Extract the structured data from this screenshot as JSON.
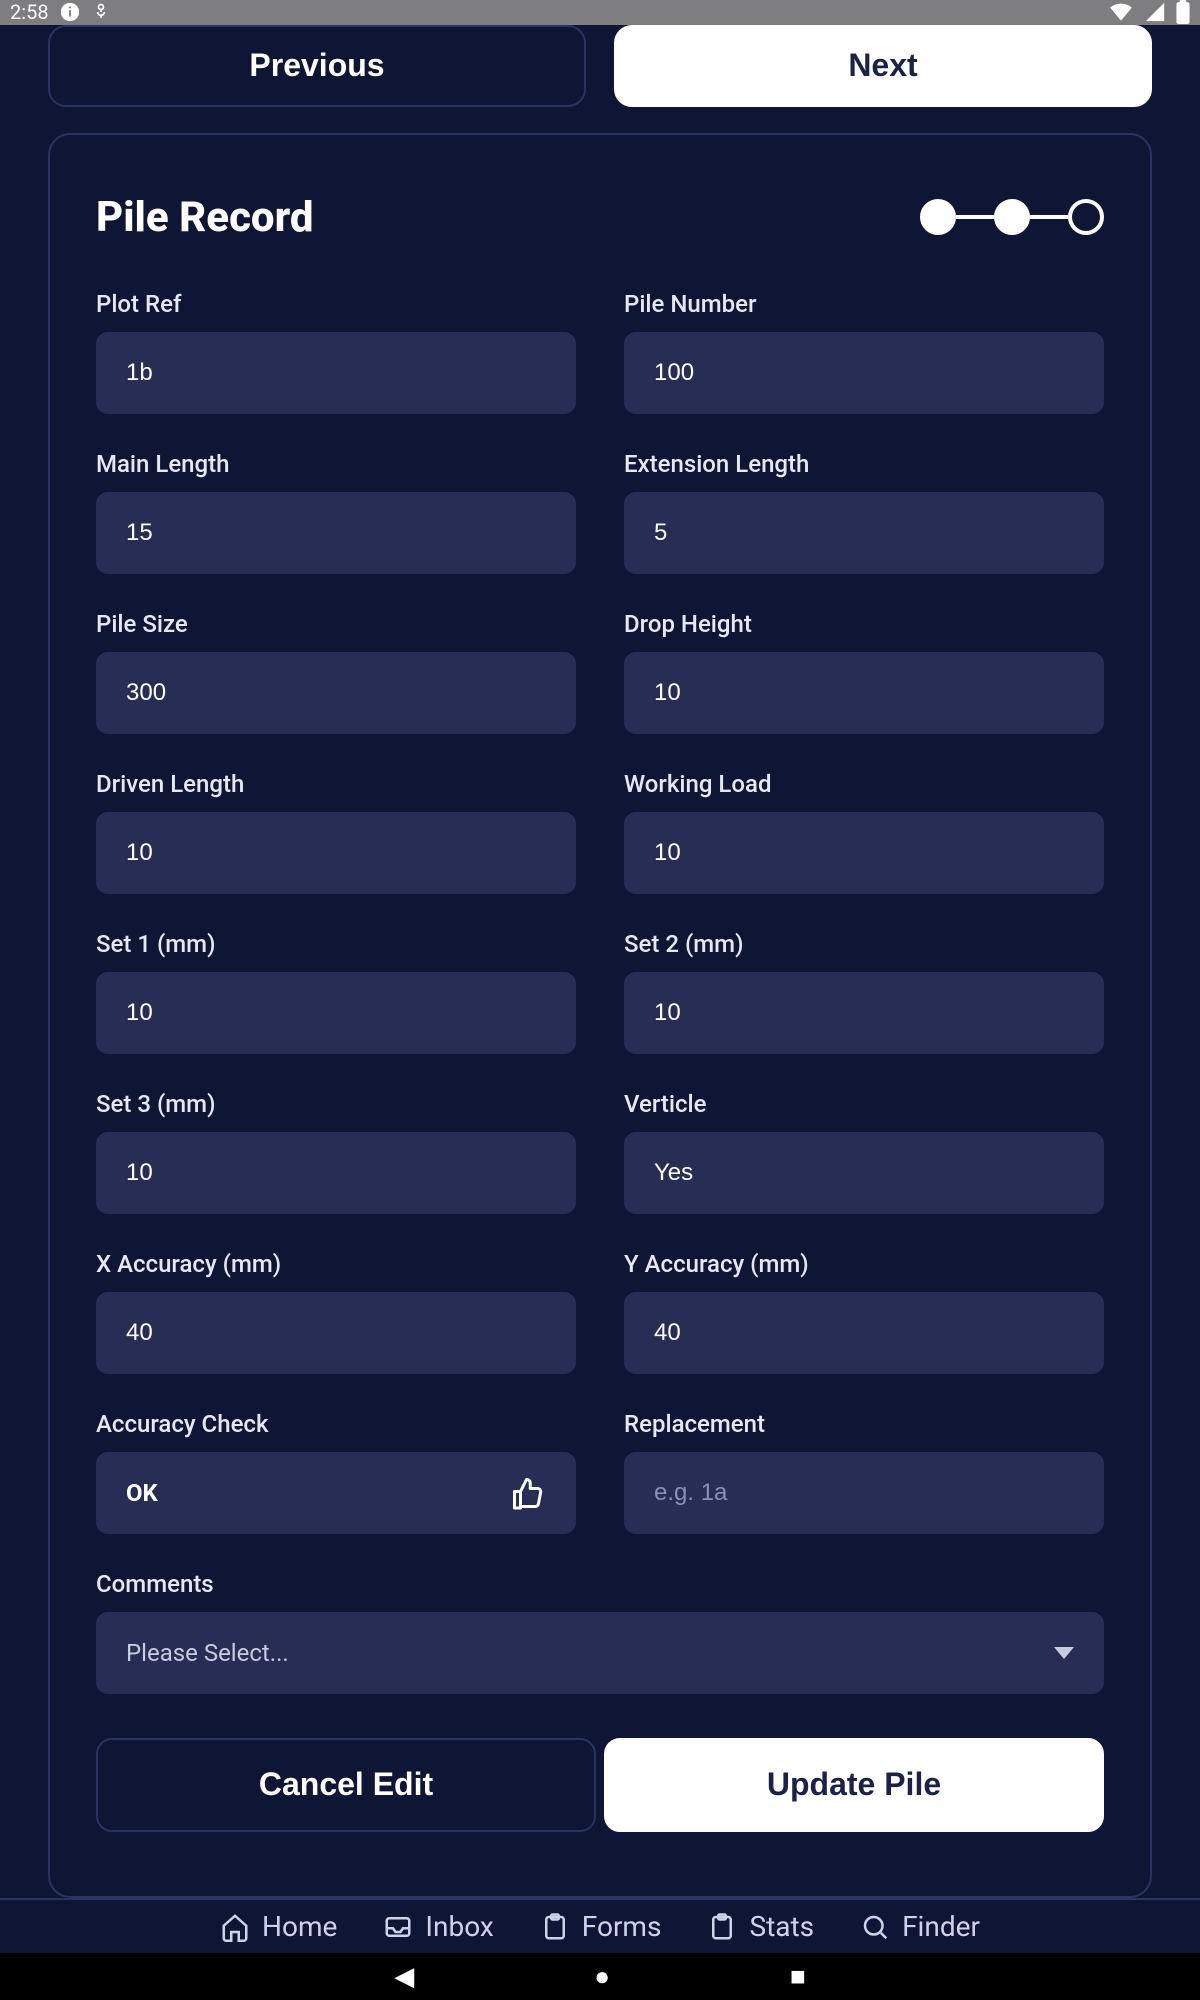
{
  "status": {
    "time": "2:58"
  },
  "topnav": {
    "prev": "Previous",
    "next": "Next"
  },
  "card": {
    "title": "Pile Record",
    "stepper": {
      "current": 2,
      "total": 3
    }
  },
  "fields": {
    "plot_ref": {
      "label": "Plot Ref",
      "value": "1b"
    },
    "pile_number": {
      "label": "Pile Number",
      "value": "100"
    },
    "main_length": {
      "label": "Main Length",
      "value": "15"
    },
    "extension_length": {
      "label": "Extension Length",
      "value": "5"
    },
    "pile_size": {
      "label": "Pile Size",
      "value": "300"
    },
    "drop_height": {
      "label": "Drop Height",
      "value": "10"
    },
    "driven_length": {
      "label": "Driven Length",
      "value": "10"
    },
    "working_load": {
      "label": "Working Load",
      "value": "10"
    },
    "set1": {
      "label": "Set 1 (mm)",
      "value": "10"
    },
    "set2": {
      "label": "Set 2 (mm)",
      "value": "10"
    },
    "set3": {
      "label": "Set 3 (mm)",
      "value": "10"
    },
    "verticle": {
      "label": "Verticle",
      "value": "Yes"
    },
    "x_accuracy": {
      "label": "X Accuracy (mm)",
      "value": "40"
    },
    "y_accuracy": {
      "label": "Y Accuracy (mm)",
      "value": "40"
    },
    "accuracy_check": {
      "label": "Accuracy Check",
      "value": "OK"
    },
    "replacement": {
      "label": "Replacement",
      "value": "",
      "placeholder": "e.g. 1a"
    },
    "comments": {
      "label": "Comments",
      "value": "Please Select..."
    }
  },
  "actions": {
    "cancel": "Cancel Edit",
    "update": "Update Pile"
  },
  "bottomnav": {
    "home": "Home",
    "inbox": "Inbox",
    "forms": "Forms",
    "stats": "Stats",
    "finder": "Finder"
  }
}
